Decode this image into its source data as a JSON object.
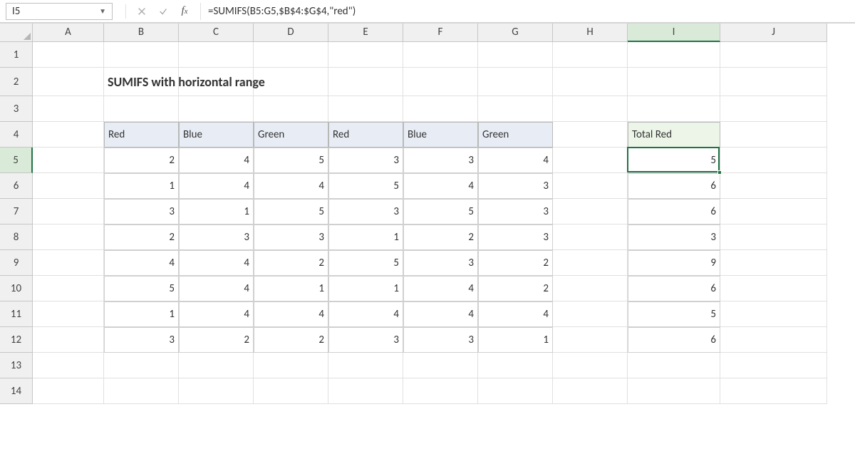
{
  "namebox": "I5",
  "formula": "=SUMIFS(B5:G5,$B$4:$G$4,\"red\")",
  "columns": [
    "A",
    "B",
    "C",
    "D",
    "E",
    "F",
    "G",
    "H",
    "I",
    "J"
  ],
  "rows": [
    "1",
    "2",
    "3",
    "4",
    "5",
    "6",
    "7",
    "8",
    "9",
    "10",
    "11",
    "12",
    "13",
    "14"
  ],
  "title": "SUMIFS with horizontal range",
  "table": {
    "headers": [
      "Red",
      "Blue",
      "Green",
      "Red",
      "Blue",
      "Green"
    ],
    "data": [
      [
        2,
        4,
        5,
        3,
        3,
        4
      ],
      [
        1,
        4,
        4,
        5,
        4,
        3
      ],
      [
        3,
        1,
        5,
        3,
        5,
        3
      ],
      [
        2,
        3,
        3,
        1,
        2,
        3
      ],
      [
        4,
        4,
        2,
        5,
        3,
        2
      ],
      [
        5,
        4,
        1,
        1,
        4,
        2
      ],
      [
        1,
        4,
        4,
        4,
        4,
        4
      ],
      [
        3,
        2,
        2,
        3,
        3,
        1
      ]
    ]
  },
  "result": {
    "header": "Total Red",
    "values": [
      5,
      6,
      6,
      3,
      9,
      6,
      5,
      6
    ]
  },
  "active_col": "I",
  "active_row": "5",
  "chart_data": {
    "type": "table",
    "title": "SUMIFS with horizontal range",
    "columns": [
      "Red",
      "Blue",
      "Green",
      "Red",
      "Blue",
      "Green",
      "Total Red"
    ],
    "rows": [
      [
        2,
        4,
        5,
        3,
        3,
        4,
        5
      ],
      [
        1,
        4,
        4,
        5,
        4,
        3,
        6
      ],
      [
        3,
        1,
        5,
        3,
        5,
        3,
        6
      ],
      [
        2,
        3,
        3,
        1,
        2,
        3,
        3
      ],
      [
        4,
        4,
        2,
        5,
        3,
        2,
        9
      ],
      [
        5,
        4,
        1,
        1,
        4,
        2,
        6
      ],
      [
        1,
        4,
        4,
        4,
        4,
        4,
        5
      ],
      [
        3,
        2,
        2,
        3,
        3,
        1,
        6
      ]
    ]
  }
}
